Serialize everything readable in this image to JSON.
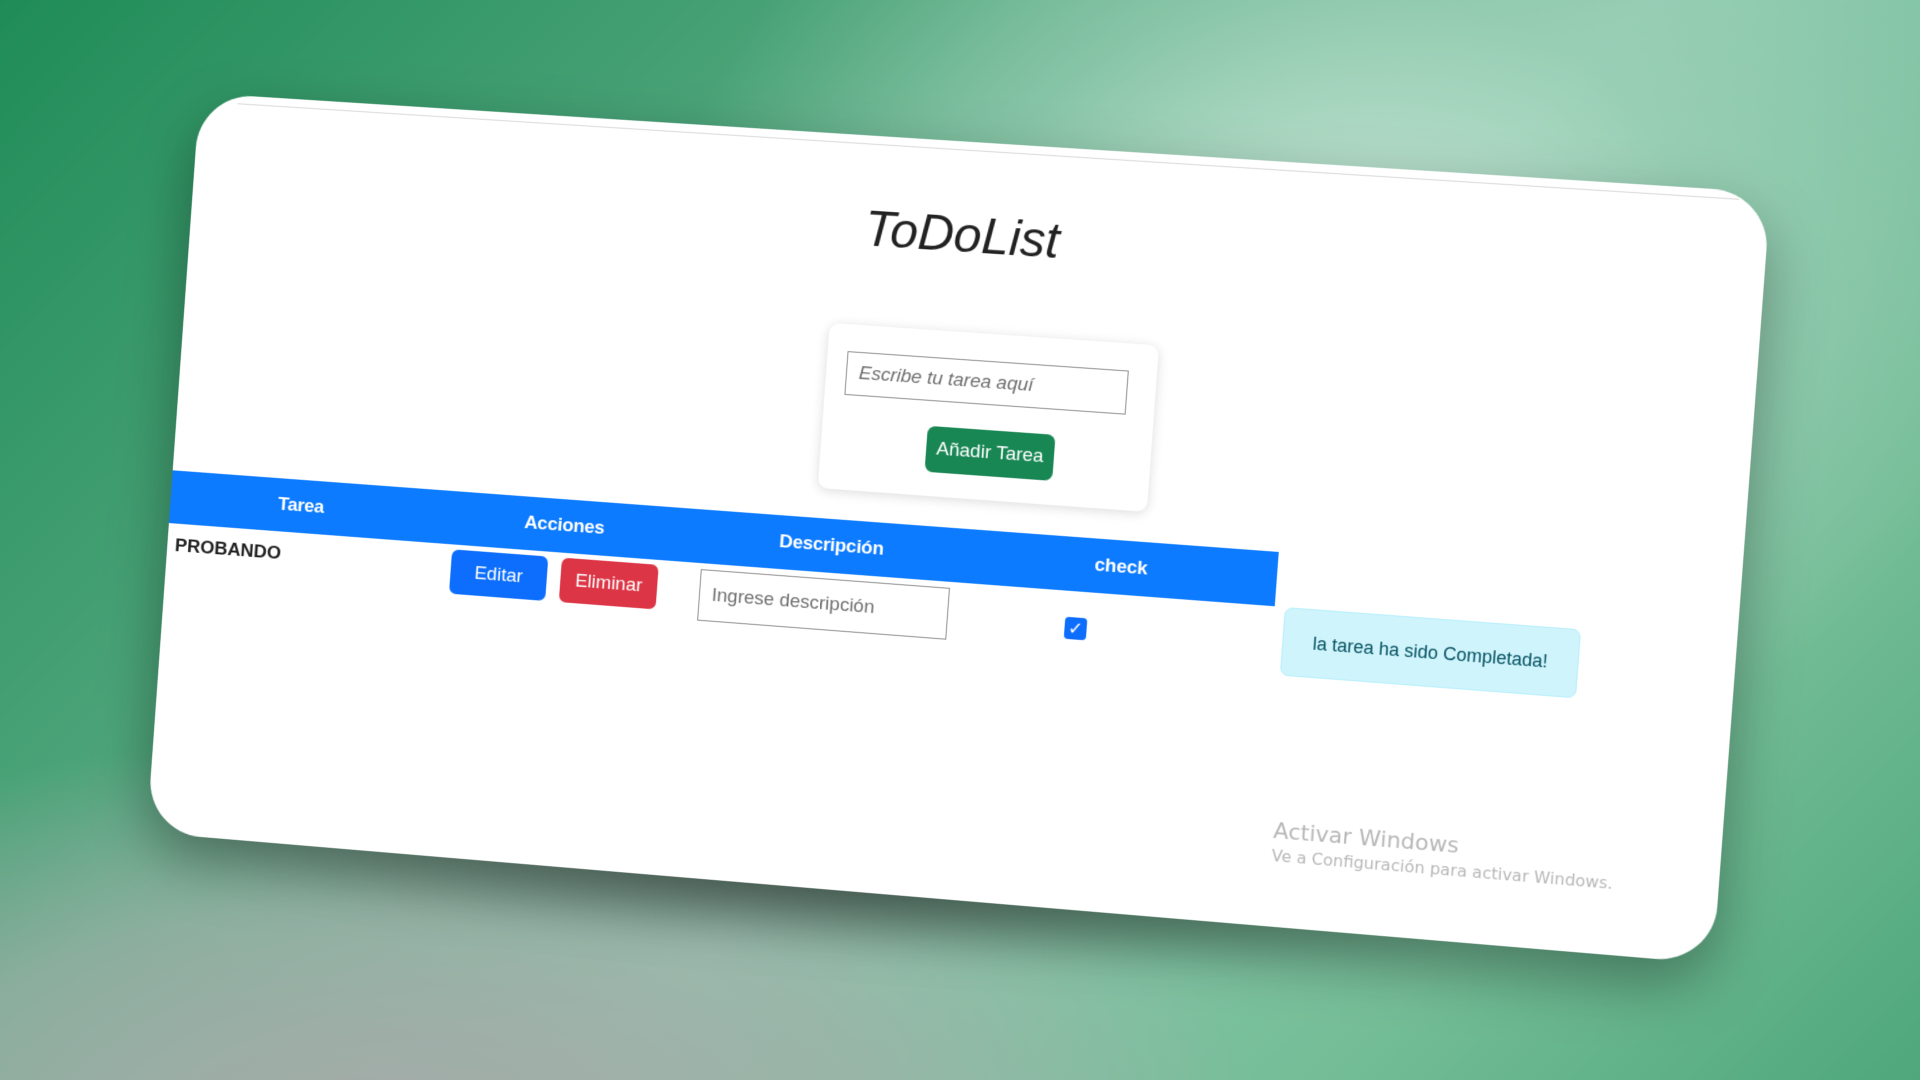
{
  "app": {
    "title": "ToDoList"
  },
  "form": {
    "task_placeholder": "Escribe tu tarea aquí",
    "add_label": "Añadir Tarea"
  },
  "table": {
    "headers": [
      "Tarea",
      "Acciones",
      "Descripción",
      "check"
    ],
    "rows": [
      {
        "task": "PROBANDO",
        "edit_label": "Editar",
        "delete_label": "Eliminar",
        "description_placeholder": "Ingrese descripción",
        "checked": true
      }
    ]
  },
  "alert": {
    "message": "la tarea ha sido Completada!"
  },
  "watermark": {
    "title": "Activar Windows",
    "subtitle": "Ve a Configuración para activar Windows."
  },
  "colors": {
    "header_blue": "#0d7bff",
    "success_green": "#198754",
    "primary_blue": "#0d6efd",
    "danger_red": "#dc3545",
    "info_bg": "#cff4fc"
  },
  "icons": {
    "check": "check-icon"
  }
}
